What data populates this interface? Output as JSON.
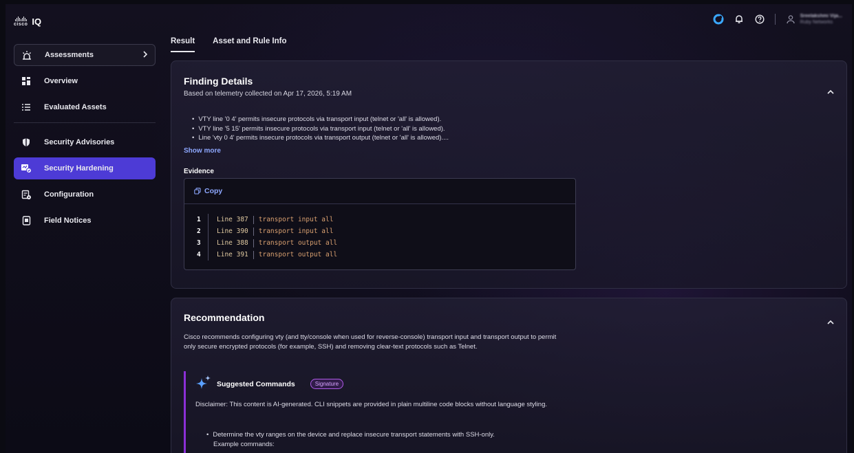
{
  "app": {
    "brand": "cisco",
    "product": "IQ"
  },
  "topbar": {
    "icons": [
      "assistant-icon",
      "bell-icon",
      "help-icon",
      "user-icon"
    ],
    "user_name": "Sreelakshmi Vija...",
    "user_org": "Ruby Networks"
  },
  "sidebar": {
    "items": [
      {
        "label": "Assessments",
        "icon": "assessments-icon"
      },
      {
        "label": "Overview",
        "icon": "overview-icon"
      },
      {
        "label": "Evaluated Assets",
        "icon": "list-icon"
      },
      {
        "label": "Security Advisories",
        "icon": "shield-icon"
      },
      {
        "label": "Security Hardening",
        "icon": "hardening-icon"
      },
      {
        "label": "Configuration",
        "icon": "configuration-icon"
      },
      {
        "label": "Field Notices",
        "icon": "notice-icon"
      }
    ],
    "active": "Security Hardening"
  },
  "tabs": [
    {
      "label": "Result"
    },
    {
      "label": "Asset and Rule Info"
    }
  ],
  "finding": {
    "title": "Finding Details",
    "subtitle": "Based on telemetry collected on Apr 17, 2026, 5:19 AM",
    "bullets": [
      "VTY line '0 4' permits insecure protocols via transport input (telnet or 'all' is allowed).",
      "VTY line '5 15' permits insecure protocols via transport input (telnet or 'all' is allowed).",
      "Line 'vty 0 4' permits insecure protocols via transport output (telnet or 'all' is allowed)...."
    ],
    "show_more": "Show more",
    "evidence_label": "Evidence",
    "copy_label": "Copy",
    "code": [
      {
        "n": "1",
        "label": "Line 387",
        "cmd": "transport input all"
      },
      {
        "n": "2",
        "label": "Line 390",
        "cmd": "transport input all"
      },
      {
        "n": "3",
        "label": "Line 388",
        "cmd": "transport output all"
      },
      {
        "n": "4",
        "label": "Line 391",
        "cmd": "transport output all"
      }
    ]
  },
  "recommendation": {
    "title": "Recommendation",
    "text": "Cisco recommends configuring vty (and tty/console when used for reverse-console) transport input and transport output to permit only secure encrypted protocols (for example, SSH) and removing clear-text protocols such as Telnet.",
    "suggested_title": "Suggested Commands",
    "badge": "Signature",
    "disclaimer": "Disclaimer: This content is AI-generated. CLI snippets are provided in plain multiline code blocks without language styling.",
    "bullet_line1": "Determine the vty ranges on the device and replace insecure transport statements with SSH-only.",
    "bullet_line2": "Example commands:"
  },
  "colors": {
    "accent": "#4d3bd6",
    "link": "#8ea8ff",
    "ai_bar": "#8b2fd6"
  }
}
